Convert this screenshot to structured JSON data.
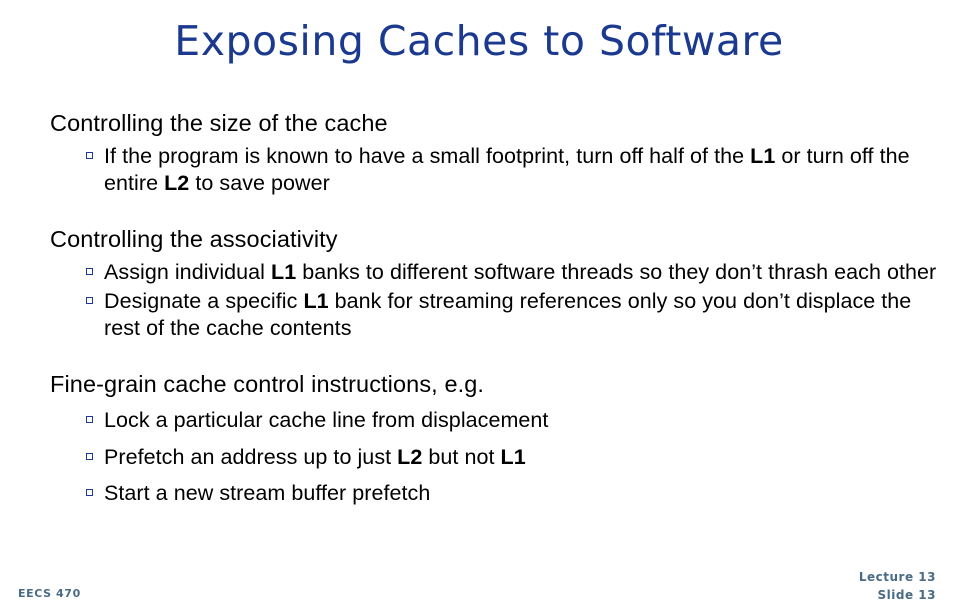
{
  "slide": {
    "title": "Exposing Caches to Software",
    "title_color": "#1b3a8f",
    "background_color": "#ffffff",
    "body_text_color": "#000000",
    "bullet_marker_color": "#1b3a8f",
    "footer_color": "#4a6b84",
    "bullet_marker_icon": "hollow-square-bullet-icon"
  },
  "content": {
    "groups": [
      {
        "heading": "Controlling the size of the cache",
        "bullets": [
          {
            "segments": [
              {
                "text": "If the program is known to have a small footprint, turn off half of the ",
                "bold": false
              },
              {
                "text": "L1",
                "bold": true
              },
              {
                "text": " or turn off the entire ",
                "bold": false
              },
              {
                "text": "L2",
                "bold": true
              },
              {
                "text": " to save power",
                "bold": false
              }
            ]
          }
        ]
      },
      {
        "heading": "Controlling the associativity",
        "bullets": [
          {
            "segments": [
              {
                "text": "Assign individual ",
                "bold": false
              },
              {
                "text": "L1",
                "bold": true
              },
              {
                "text": " banks to different software threads so they don’t thrash each other",
                "bold": false
              }
            ]
          },
          {
            "segments": [
              {
                "text": "Designate a specific ",
                "bold": false
              },
              {
                "text": "L1",
                "bold": true
              },
              {
                "text": " bank for streaming references only so you don’t displace the rest of the cache contents",
                "bold": false
              }
            ]
          }
        ]
      },
      {
        "heading": "Fine-grain cache control instructions, e.g.",
        "bullets": [
          {
            "segments": [
              {
                "text": "Lock a particular cache line from displacement",
                "bold": false
              }
            ]
          },
          {
            "segments": [
              {
                "text": "Prefetch an address up to just ",
                "bold": false
              },
              {
                "text": "L2",
                "bold": true
              },
              {
                "text": " but not ",
                "bold": false
              },
              {
                "text": "L1",
                "bold": true
              }
            ]
          },
          {
            "segments": [
              {
                "text": "Start a new stream buffer prefetch",
                "bold": false
              }
            ]
          }
        ]
      }
    ]
  },
  "footer": {
    "course": "EECS 470",
    "lecture": "Lecture 13",
    "slide_number": "Slide 13"
  }
}
